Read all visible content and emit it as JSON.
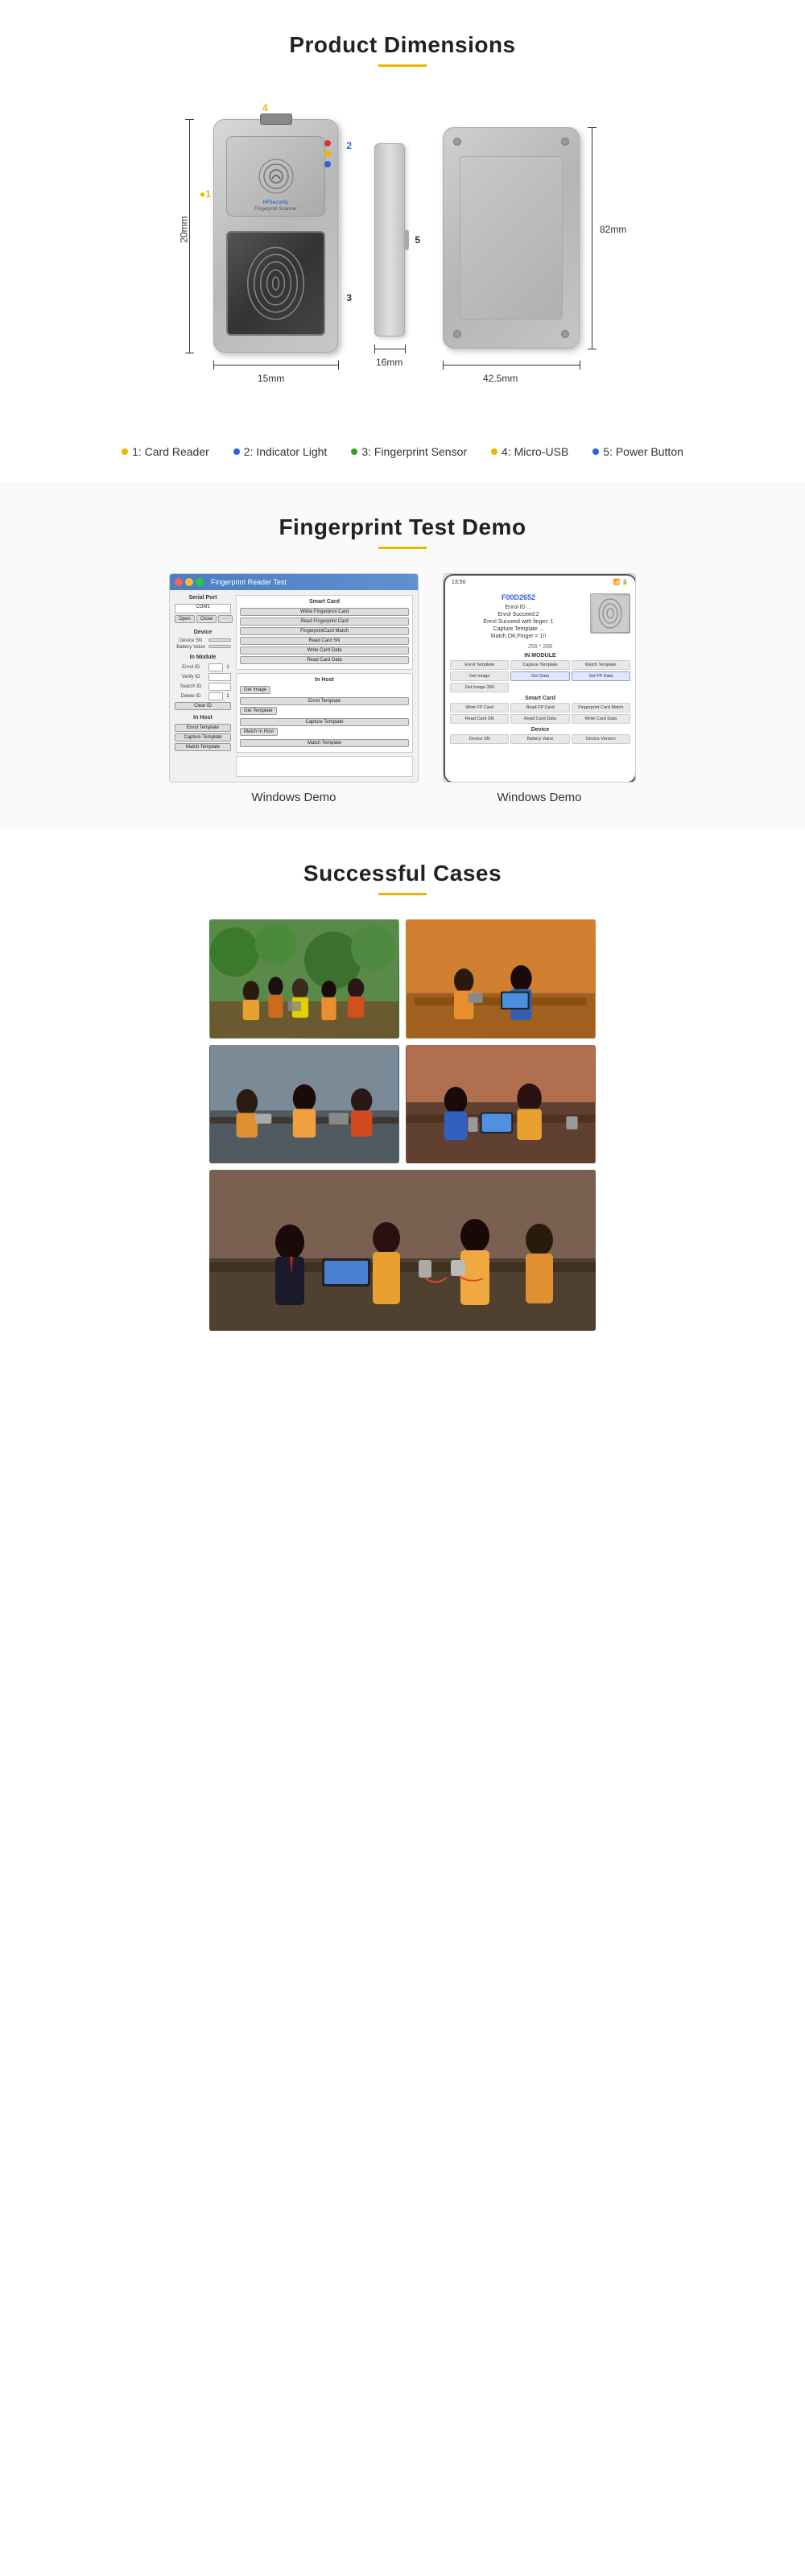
{
  "sections": {
    "dimensions": {
      "title": "Product Dimensions",
      "labels": [
        {
          "key": "1",
          "text": "1: Card Reader",
          "color": "yellow"
        },
        {
          "key": "2",
          "text": "2: Indicator Light",
          "color": "blue"
        },
        {
          "key": "3",
          "text": "3: Fingerprint Sensor",
          "color": "green"
        },
        {
          "key": "4",
          "text": "4: Micro-USB",
          "color": "yellow"
        },
        {
          "key": "5",
          "text": "5: Power Button",
          "color": "blue"
        }
      ],
      "measurements": {
        "left": "20mm",
        "bottom1": "15mm",
        "bottom2": "16mm",
        "bottom3": "42.5mm",
        "right": "82mm"
      }
    },
    "demo": {
      "title": "Fingerprint Test Demo",
      "windows_title": "Fingerprint Reader Test",
      "caption1": "Windows Demo",
      "caption2": "Windows Demo",
      "serial_port_label": "Serial Port",
      "open_btn": "Open",
      "close_btn": "Close",
      "device_section": "Device",
      "device_sn_label": "Device SN",
      "battery_value_label": "Battery Value",
      "smart_card_section": "Smart Card",
      "smart_card_buttons": [
        "Wirite Fingerprint Card",
        "Read Fingerprint Card",
        "FingerprintCard Match",
        "Read Card SN",
        "Write Card Data",
        "Read Card Data"
      ],
      "in_module_section": "In Module",
      "module_rows": [
        {
          "label": "Enrol ID",
          "value": "1"
        },
        {
          "label": "Verify ID",
          "value": ""
        },
        {
          "label": "Search ID",
          "value": ""
        },
        {
          "label": "Delete ID",
          "value": "1"
        }
      ],
      "clear_id_btn": "Clear ID",
      "in_host_section": "In Host",
      "in_host_buttons": [
        "Enrol Template",
        "Capture Template",
        "Match Template"
      ],
      "get_image_btn": "Get Image",
      "get_template_btn": "Get Template",
      "match_in_host_btn": "Match In Host",
      "mobile_id": "F00D2652",
      "mobile_texts": [
        "Enrol ID ...",
        "Enrol Succeed:2",
        "Enrol Succeed with finger: 1",
        "Capture Template ...",
        "Match OK;Finger = 1!!"
      ],
      "mobile_size": "256 * 288",
      "mobile_in_module": "IN MODULE",
      "mobile_buttons_module": [
        "Enrol Template",
        "Capture Template",
        "Match Template",
        "Get Image",
        "Get Image 360"
      ],
      "mobile_get_data": "Get Data",
      "mobile_set_data": "Set FP Data",
      "mobile_smart_card": "Smart Card",
      "mobile_sc_buttons": [
        "Write FP Card",
        "Read FP Card",
        "Fingerprint Card Match",
        "Read Card SN",
        "Read Card Data",
        "Write Card Data"
      ],
      "mobile_device": "Device",
      "mobile_device_buttons": [
        "Device SN",
        "Battery Value",
        "Device Version"
      ]
    },
    "cases": {
      "title": "Successful Cases",
      "photos": [
        {
          "id": "photo-1",
          "alt": "Group using fingerprint scanner outdoors"
        },
        {
          "id": "photo-2",
          "alt": "People using tablet device"
        },
        {
          "id": "photo-3",
          "alt": "Meeting with fingerprint scanner"
        },
        {
          "id": "photo-4",
          "alt": "People using device at table"
        },
        {
          "id": "photo-5",
          "alt": "Person demonstrating device"
        }
      ]
    }
  }
}
